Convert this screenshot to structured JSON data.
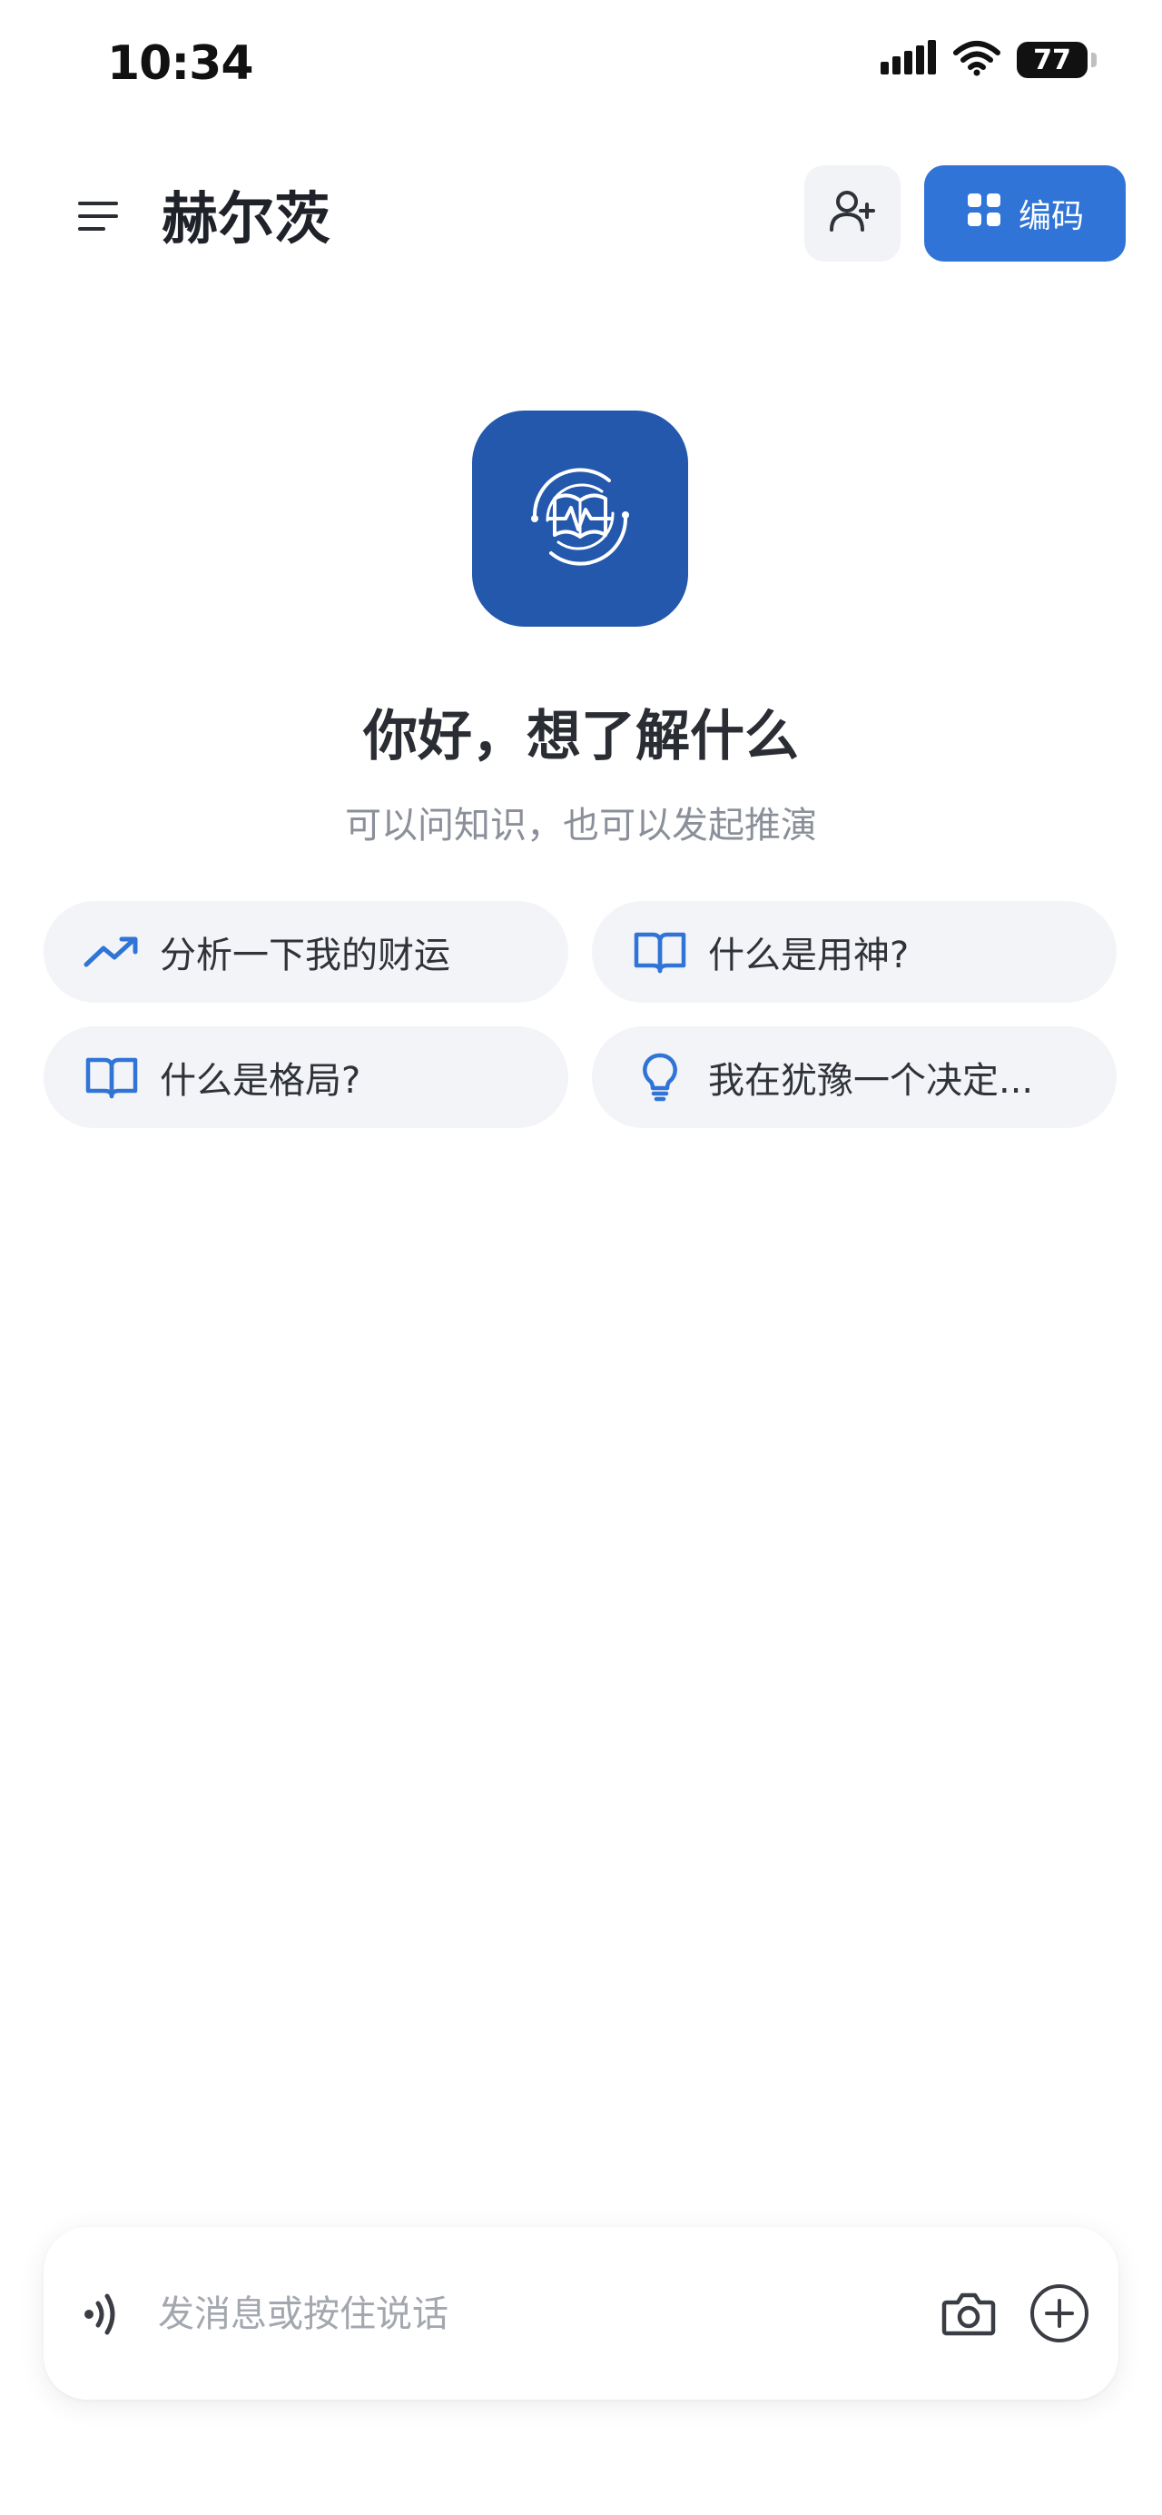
{
  "status_bar": {
    "time": "10:34",
    "battery": "77",
    "icons": [
      "signal-icon",
      "wifi-icon",
      "battery-icon"
    ]
  },
  "header": {
    "title": "赫尔茨",
    "menu_icon": "hamburger-menu-icon",
    "add_user_icon": "add-user-icon",
    "code_button_label": "编码",
    "code_button_icon": "grid-icon"
  },
  "hero": {
    "logo_icon": "book-heartbeat-logo",
    "greeting": "你好，想了解什么",
    "subtitle": "可以问知识，也可以发起推演"
  },
  "suggestions": [
    {
      "label": "分析一下我的财运",
      "icon": "trending-up-icon"
    },
    {
      "label": "什么是用神?",
      "icon": "book-open-icon"
    },
    {
      "label": "什么是格局?",
      "icon": "book-open-icon"
    },
    {
      "label": "我在犹豫一个决定...",
      "icon": "lightbulb-icon"
    }
  ],
  "composer": {
    "placeholder": "发消息或按住说话",
    "voice_icon": "voice-icon",
    "camera_icon": "camera-icon",
    "plus_icon": "plus-circle-icon"
  },
  "colors": {
    "accent": "#2f74d6",
    "logo_bg": "#2458ad",
    "chip_bg": "#f3f4f7"
  }
}
